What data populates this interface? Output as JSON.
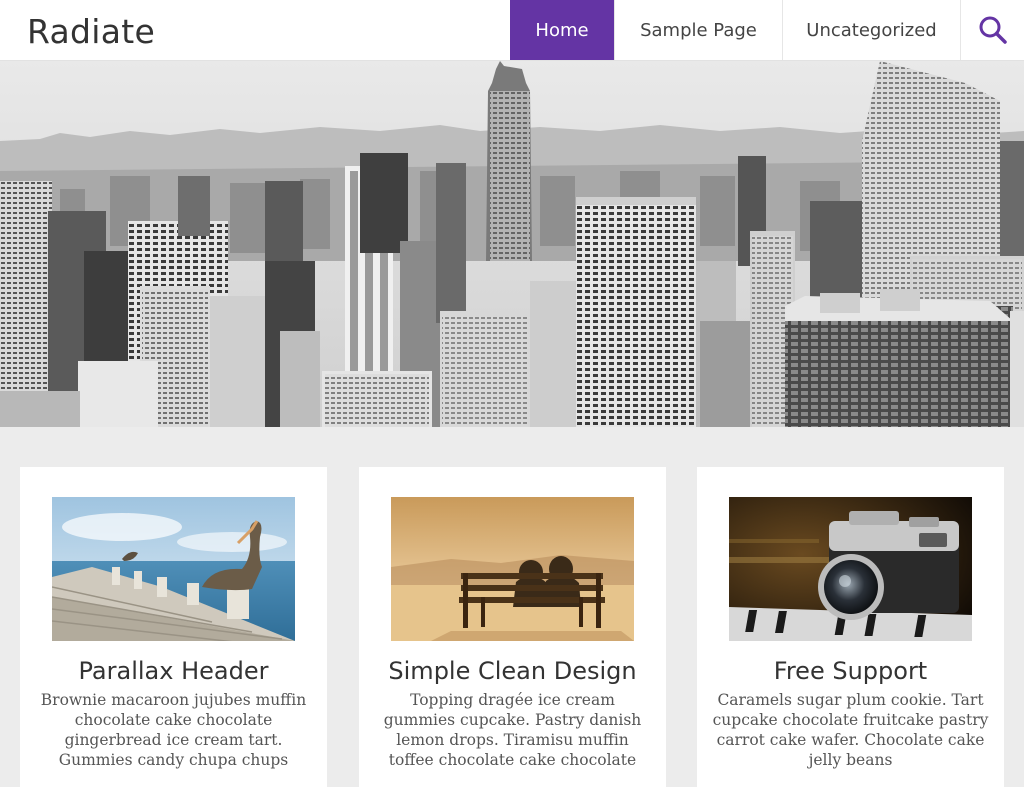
{
  "site": {
    "title": "Radiate"
  },
  "nav": {
    "items": [
      {
        "label": "Home"
      },
      {
        "label": "Sample Page"
      },
      {
        "label": "Uncategorized"
      }
    ]
  },
  "colors": {
    "accent": "#6434a4",
    "background": "#ececec",
    "card": "#ffffff"
  },
  "icons": {
    "search": "search-icon"
  },
  "cards": [
    {
      "title": "Parallax Header",
      "text": "Brownie macaroon jujubes muffin chocolate cake chocolate gingerbread ice cream tart. Gummies candy chupa chups"
    },
    {
      "title": "Simple Clean Design",
      "text": "Topping dragée ice cream gummies cupcake. Pastry danish lemon drops. Tiramisu muffin toffee chocolate cake chocolate"
    },
    {
      "title": "Free Support",
      "text": "Caramels sugar plum cookie. Tart cupcake chocolate fruitcake pastry carrot cake wafer. Chocolate cake jelly beans"
    }
  ]
}
